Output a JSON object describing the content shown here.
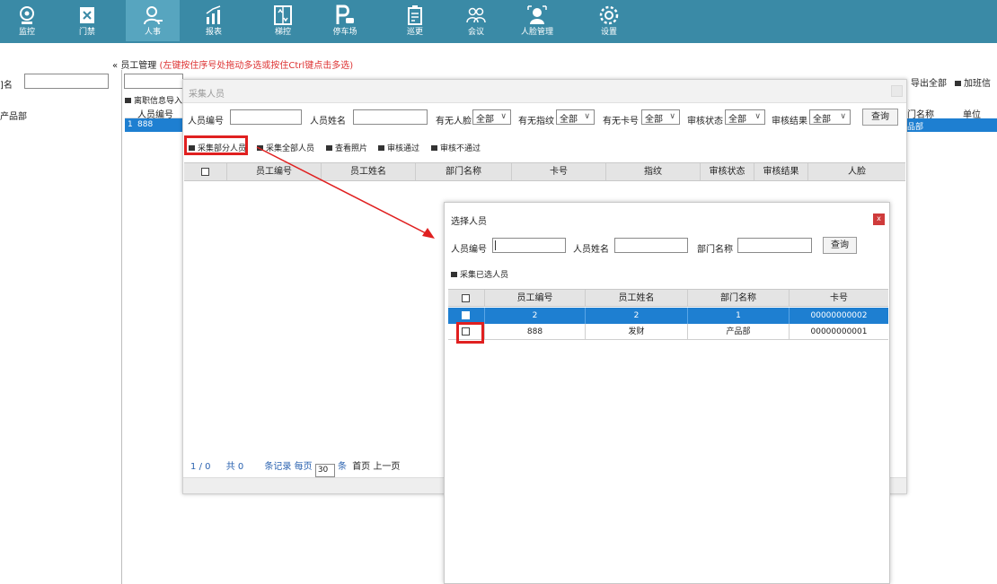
{
  "nav": {
    "items": [
      {
        "label": "监控",
        "icon": "camera-icon"
      },
      {
        "label": "门禁",
        "icon": "door-icon"
      },
      {
        "label": "人事",
        "icon": "user-icon"
      },
      {
        "label": "报表",
        "icon": "chart-icon"
      },
      {
        "label": "梯控",
        "icon": "elevator-icon"
      },
      {
        "label": "停车场",
        "icon": "parking-icon"
      },
      {
        "label": "巡更",
        "icon": "patrol-icon"
      },
      {
        "label": "会议",
        "icon": "meeting-icon"
      },
      {
        "label": "人脸管理",
        "icon": "face-icon"
      },
      {
        "label": "设置",
        "icon": "gear-icon"
      }
    ],
    "active": "人事"
  },
  "page": {
    "breadcrumb_prefix": "«",
    "breadcrumb": "员工管理",
    "breadcrumb_hint": "(左键按住序号处拖动多选或按住Ctrl键点击多选)",
    "left_label": "]名",
    "left_dept": "产品部",
    "resign_export": "离职信息导入",
    "bg_table_header": [
      "人员编号",
      "门名称",
      "单位"
    ],
    "bg_table_row": {
      "index": "1",
      "id": "888",
      "dept": "品部"
    },
    "toolbar_right": [
      "导出全部",
      "加班信"
    ]
  },
  "collect_dialog": {
    "title": "采集人员",
    "filters": {
      "id_label": "人员编号",
      "name_label": "人员姓名",
      "face_label": "有无人脸",
      "face_value": "全部",
      "fp_label": "有无指纹",
      "fp_value": "全部",
      "card_label": "有无卡号",
      "card_value": "全部",
      "audit_status_label": "审核状态",
      "audit_status_value": "全部",
      "audit_result_label": "审核结果",
      "audit_result_value": "全部",
      "query_button": "查询"
    },
    "toolbar": [
      "采集部分人员",
      "采集全部人员",
      "查看照片",
      "审核通过",
      "审核不通过"
    ],
    "columns": [
      "员工编号",
      "员工姓名",
      "部门名称",
      "卡号",
      "指纹",
      "审核状态",
      "审核结果",
      "人脸"
    ],
    "pager": {
      "current": "1",
      "sep": "/",
      "total_pages": "0",
      "total_label": "共",
      "total_count": "0",
      "records_label": "条记录",
      "per_page_label": "每页",
      "per_page_value": "30",
      "unit": "条",
      "first": "首页",
      "prev": "上一页"
    }
  },
  "select_dialog": {
    "title": "选择人员",
    "close_label": "x",
    "filters": {
      "id_label": "人员编号",
      "id_value": "",
      "name_label": "人员姓名",
      "dept_label": "部门名称",
      "query_button": "查询"
    },
    "toolbar": [
      "采集已选人员"
    ],
    "columns": [
      "员工编号",
      "员工姓名",
      "部门名称",
      "卡号"
    ],
    "rows": [
      {
        "id": "2",
        "name": "2",
        "dept": "1",
        "card": "00000000002",
        "selected": true
      },
      {
        "id": "888",
        "name": "发财",
        "dept": "产品部",
        "card": "00000000001",
        "selected": false
      }
    ]
  },
  "colors": {
    "topbar": "#3a8aa6",
    "selected_row": "#1e7fd1",
    "highlight": "#e02020"
  }
}
